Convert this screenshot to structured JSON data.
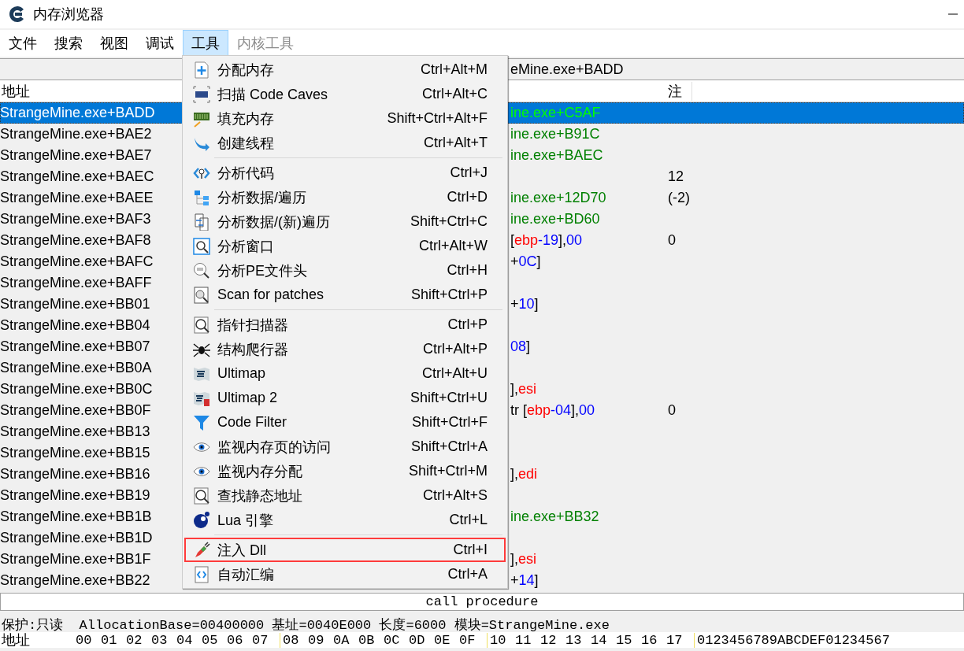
{
  "window": {
    "title": "内存浏览器"
  },
  "menubar": [
    {
      "label": "文件",
      "selected": false,
      "disabled": false
    },
    {
      "label": "搜索",
      "selected": false,
      "disabled": false
    },
    {
      "label": "视图",
      "selected": false,
      "disabled": false
    },
    {
      "label": "调试",
      "selected": false,
      "disabled": false
    },
    {
      "label": "工具",
      "selected": true,
      "disabled": false
    },
    {
      "label": "内核工具",
      "selected": false,
      "disabled": true
    }
  ],
  "address_bar": {
    "value": "eMine.exe+BADD"
  },
  "table": {
    "columns": [
      "地址",
      "注"
    ],
    "rows": [
      {
        "address": "StrangeMine.exe+BADD",
        "selected": true,
        "code": [
          {
            "kind": "symbol",
            "text": "ine.exe+C5AF"
          }
        ]
      },
      {
        "address": "StrangeMine.exe+BAE2",
        "selected": false,
        "code": [
          {
            "kind": "symbol",
            "text": "ine.exe+B91C"
          }
        ]
      },
      {
        "address": "StrangeMine.exe+BAE7",
        "selected": false,
        "code": [
          {
            "kind": "symbol",
            "text": "ine.exe+BAEC"
          }
        ]
      },
      {
        "address": "StrangeMine.exe+BAEC",
        "selected": false,
        "comment": "12"
      },
      {
        "address": "StrangeMine.exe+BAEE",
        "selected": false,
        "code": [
          {
            "kind": "symbol",
            "text": "ine.exe+12D70"
          }
        ],
        "comment": "(-2)"
      },
      {
        "address": "StrangeMine.exe+BAF3",
        "selected": false,
        "code": [
          {
            "kind": "symbol",
            "text": "ine.exe+BD60"
          }
        ]
      },
      {
        "address": "StrangeMine.exe+BAF8",
        "selected": false,
        "code": [
          {
            "kind": "plain",
            "text": "["
          },
          {
            "kind": "register",
            "text": "ebp"
          },
          {
            "kind": "number",
            "text": "-19"
          },
          {
            "kind": "plain",
            "text": "],"
          },
          {
            "kind": "number",
            "text": "00"
          }
        ],
        "comment": "0"
      },
      {
        "address": "StrangeMine.exe+BAFC",
        "selected": false,
        "code": [
          {
            "kind": "plain",
            "text": "+"
          },
          {
            "kind": "number",
            "text": "0C"
          },
          {
            "kind": "plain",
            "text": "]"
          }
        ]
      },
      {
        "address": "StrangeMine.exe+BAFF",
        "selected": false
      },
      {
        "address": "StrangeMine.exe+BB01",
        "selected": false,
        "code": [
          {
            "kind": "plain",
            "text": "+"
          },
          {
            "kind": "number",
            "text": "10"
          },
          {
            "kind": "plain",
            "text": "]"
          }
        ]
      },
      {
        "address": "StrangeMine.exe+BB04",
        "selected": false
      },
      {
        "address": "StrangeMine.exe+BB07",
        "selected": false,
        "code": [
          {
            "kind": "number",
            "text": "08"
          },
          {
            "kind": "plain",
            "text": "]"
          }
        ]
      },
      {
        "address": "StrangeMine.exe+BB0A",
        "selected": false
      },
      {
        "address": "StrangeMine.exe+BB0C",
        "selected": false,
        "code": [
          {
            "kind": "plain",
            "text": "],"
          },
          {
            "kind": "register",
            "text": "esi"
          }
        ]
      },
      {
        "address": "StrangeMine.exe+BB0F",
        "selected": false,
        "code": [
          {
            "kind": "plain",
            "text": "tr ["
          },
          {
            "kind": "register",
            "text": "ebp"
          },
          {
            "kind": "number",
            "text": "-04"
          },
          {
            "kind": "plain",
            "text": "],"
          },
          {
            "kind": "number",
            "text": "00"
          }
        ],
        "comment": "0"
      },
      {
        "address": "StrangeMine.exe+BB13",
        "selected": false
      },
      {
        "address": "StrangeMine.exe+BB15",
        "selected": false
      },
      {
        "address": "StrangeMine.exe+BB16",
        "selected": false,
        "code": [
          {
            "kind": "plain",
            "text": "],"
          },
          {
            "kind": "register",
            "text": "edi"
          }
        ]
      },
      {
        "address": "StrangeMine.exe+BB19",
        "selected": false
      },
      {
        "address": "StrangeMine.exe+BB1B",
        "selected": false,
        "code": [
          {
            "kind": "symbol",
            "text": "ine.exe+BB32"
          }
        ]
      },
      {
        "address": "StrangeMine.exe+BB1D",
        "selected": false
      },
      {
        "address": "StrangeMine.exe+BB1F",
        "selected": false,
        "code": [
          {
            "kind": "plain",
            "text": "],"
          },
          {
            "kind": "register",
            "text": "esi"
          }
        ]
      },
      {
        "address": "StrangeMine.exe+BB22",
        "selected": false,
        "code": [
          {
            "kind": "plain",
            "text": "+"
          },
          {
            "kind": "number",
            "text": "14"
          },
          {
            "kind": "plain",
            "text": "]"
          }
        ]
      }
    ]
  },
  "tools_menu": {
    "items": [
      {
        "label": "分配内存",
        "shortcut": "Ctrl+Alt+M",
        "outlined": false,
        "separator_after": false
      },
      {
        "label": "扫描 Code Caves",
        "shortcut": "Ctrl+Alt+C",
        "outlined": false,
        "separator_after": false
      },
      {
        "label": "填充内存",
        "shortcut": "Shift+Ctrl+Alt+F",
        "outlined": false,
        "separator_after": false
      },
      {
        "label": "创建线程",
        "shortcut": "Ctrl+Alt+T",
        "outlined": false,
        "separator_after": true
      },
      {
        "label": "分析代码",
        "shortcut": "Ctrl+J",
        "outlined": false,
        "separator_after": false
      },
      {
        "label": "分析数据/遍历",
        "shortcut": "Ctrl+D",
        "outlined": false,
        "separator_after": false
      },
      {
        "label": "分析数据/(新)遍历",
        "shortcut": "Shift+Ctrl+C",
        "outlined": false,
        "separator_after": false
      },
      {
        "label": "分析窗口",
        "shortcut": "Ctrl+Alt+W",
        "outlined": false,
        "separator_after": false
      },
      {
        "label": "分析PE文件头",
        "shortcut": "Ctrl+H",
        "outlined": false,
        "separator_after": false
      },
      {
        "label": "Scan for patches",
        "shortcut": "Shift+Ctrl+P",
        "outlined": false,
        "separator_after": true
      },
      {
        "label": "指针扫描器",
        "shortcut": "Ctrl+P",
        "outlined": false,
        "separator_after": false
      },
      {
        "label": "结构爬行器",
        "shortcut": "Ctrl+Alt+P",
        "outlined": false,
        "separator_after": false
      },
      {
        "label": "Ultimap",
        "shortcut": "Ctrl+Alt+U",
        "outlined": false,
        "separator_after": false
      },
      {
        "label": "Ultimap 2",
        "shortcut": "Shift+Ctrl+U",
        "outlined": false,
        "separator_after": false
      },
      {
        "label": "Code Filter",
        "shortcut": "Shift+Ctrl+F",
        "outlined": false,
        "separator_after": false
      },
      {
        "label": "监视内存页的访问",
        "shortcut": "Shift+Ctrl+A",
        "outlined": false,
        "separator_after": false
      },
      {
        "label": "监视内存分配",
        "shortcut": "Shift+Ctrl+M",
        "outlined": false,
        "separator_after": false
      },
      {
        "label": "查找静态地址",
        "shortcut": "Ctrl+Alt+S",
        "outlined": false,
        "separator_after": false
      },
      {
        "label": "Lua 引擎",
        "shortcut": "Ctrl+L",
        "outlined": false,
        "separator_after": true
      },
      {
        "label": "注入 Dll",
        "shortcut": "Ctrl+I",
        "outlined": true,
        "separator_after": false
      },
      {
        "label": "自动汇编",
        "shortcut": "Ctrl+A",
        "outlined": false,
        "separator_after": false
      }
    ]
  },
  "instruction_hint": "call procedure",
  "status_line": "保护:只读  AllocationBase=00400000 基址=0040E000 长度=6000 模块=StrangeMine.exe",
  "hex_header": {
    "label": "地址",
    "bytes": [
      "00",
      "01",
      "02",
      "03",
      "04",
      "05",
      "06",
      "07",
      "08",
      "09",
      "0A",
      "0B",
      "0C",
      "0D",
      "0E",
      "0F",
      "10",
      "11",
      "12",
      "13",
      "14",
      "15",
      "16",
      "17"
    ],
    "ascii": "0123456789ABCDEF01234567"
  }
}
